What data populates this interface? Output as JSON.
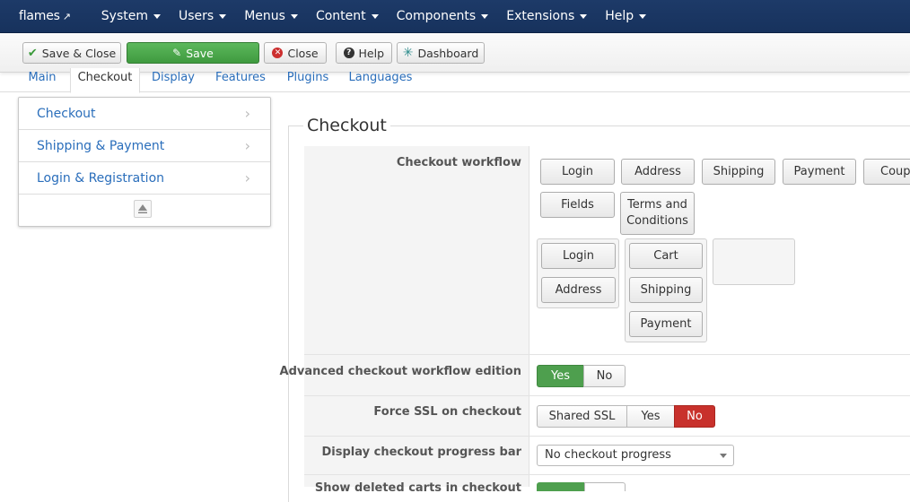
{
  "navbar": {
    "brand": "flames",
    "menus": [
      "System",
      "Users",
      "Menus",
      "Content",
      "Components",
      "Extensions",
      "Help"
    ]
  },
  "toolbar": {
    "save_close": "Save & Close",
    "save": "Save",
    "close": "Close",
    "help": "Help",
    "dashboard": "Dashboard"
  },
  "tabs": [
    "Main",
    "Checkout",
    "Display",
    "Features",
    "Plugins",
    "Languages"
  ],
  "active_tab": "Checkout",
  "sidemenu": {
    "items": [
      "Checkout",
      "Shipping & Payment",
      "Login & Registration"
    ]
  },
  "section": {
    "title": "Checkout"
  },
  "fields": {
    "workflow": {
      "label": "Checkout workflow",
      "available": [
        "Login",
        "Address",
        "Shipping",
        "Payment",
        "Coupo",
        "Fields",
        "Terms and Conditions"
      ],
      "step1": [
        "Login",
        "Address"
      ],
      "step2": [
        "Cart",
        "Shipping",
        "Payment"
      ]
    },
    "advanced": {
      "label": "Advanced checkout workflow edition",
      "options": [
        "Yes",
        "No"
      ],
      "selected": "Yes"
    },
    "force_ssl": {
      "label": "Force SSL on checkout",
      "options": [
        "Shared SSL",
        "Yes",
        "No"
      ],
      "selected": "No"
    },
    "progress_bar": {
      "label": "Display checkout progress bar",
      "value": "No checkout progress"
    },
    "partial_row": {
      "label": "Show deleted carts in checkout"
    }
  },
  "colors": {
    "navbar": "#17325d",
    "link": "#2a6ebb",
    "green": "#4e9f4e",
    "red": "#c8312c"
  }
}
